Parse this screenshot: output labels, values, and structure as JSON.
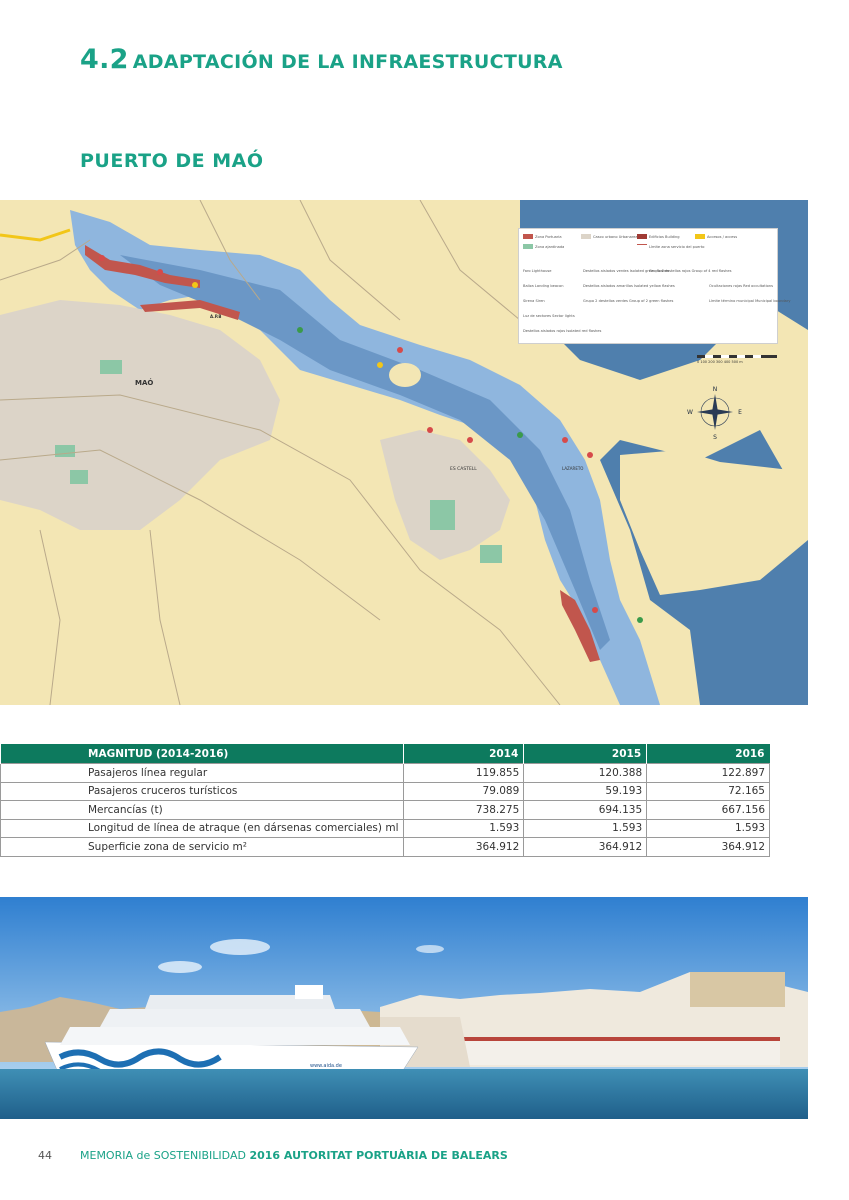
{
  "header": {
    "section_number": "4.2",
    "section_title": "ADAPTACIÓN DE LA INFRAESTRUCTURA"
  },
  "port": {
    "title": "PUERTO DE MAÓ"
  },
  "map": {
    "colors": {
      "sea": "#4f7fad",
      "land": "#f3e6b4",
      "harbour": "#8fb6de",
      "urban": "#dcd4c8",
      "green": "#8cc7a6",
      "port_zone": "#c1564d"
    },
    "labels": {
      "town": "MAÓ",
      "es_castell": "ES CASTELL",
      "apb": "A.P.B",
      "lazareto": "LAZARETO"
    },
    "legend": {
      "zona_portuaria": "Zona Portuaria",
      "zona_ajardinada": "Zona ajardinada",
      "casco_urbano": "Casco urbano Urbanarea",
      "edificios": "Edificios Building",
      "limite_zona": "Límite zona servicio del puerto",
      "accesos": "Accesos / access",
      "faro": "Faro Lighthouse",
      "baliza": "Baliza Landing beacon",
      "sirena": "Sirena Siren",
      "luz_sectores": "Luz de sectores Sector lights",
      "destellos_rojos": "Destellos aislados rojos Isolated red flashes",
      "destellos_verdes": "Destellos aislados verdes Isolated green flashes",
      "destellos_amarillos": "Destellos aislados amarillos Isolated yellow flashes",
      "grupo_verdes": "Grupo 2 destellos verdes Group of 2 green flashes",
      "grupo_rojos": "Grupo 4 destellos rojos Group of 4 red flashes",
      "ocultaciones": "Ocultaciones rojas Red occultations",
      "limite_termino": "Límite término municipal Municipal boundary"
    },
    "compass": {
      "n": "N",
      "s": "S",
      "e": "E",
      "w": "W"
    },
    "scale_text": "0 100 200 300 400 500 m"
  },
  "table": {
    "header": {
      "label": "MAGNITUD (2014-2016)",
      "y2014": "2014",
      "y2015": "2015",
      "y2016": "2016"
    },
    "rows": [
      {
        "label": "Pasajeros línea regular",
        "v2014": "119.855",
        "v2015": "120.388",
        "v2016": "122.897"
      },
      {
        "label": "Pasajeros cruceros turísticos",
        "v2014": "79.089",
        "v2015": "59.193",
        "v2016": "72.165"
      },
      {
        "label": "Mercancías (t)",
        "v2014": "738.275",
        "v2015": "694.135",
        "v2016": "667.156"
      },
      {
        "label": "Longitud de línea de atraque (en dársenas comerciales) ml",
        "v2014": "1.593",
        "v2015": "1.593",
        "v2016": "1.593"
      },
      {
        "label": "Superficie zona de servicio m²",
        "v2014": "364.912",
        "v2015": "364.912",
        "v2016": "364.912"
      }
    ]
  },
  "photo": {
    "ship_text": "www.aida.de"
  },
  "footer": {
    "page_number": "44",
    "memoria": "MEMORIA de SOSTENIBILIDAD",
    "title": "2016 AUTORITAT PORTUÀRIA DE BALEARS"
  }
}
